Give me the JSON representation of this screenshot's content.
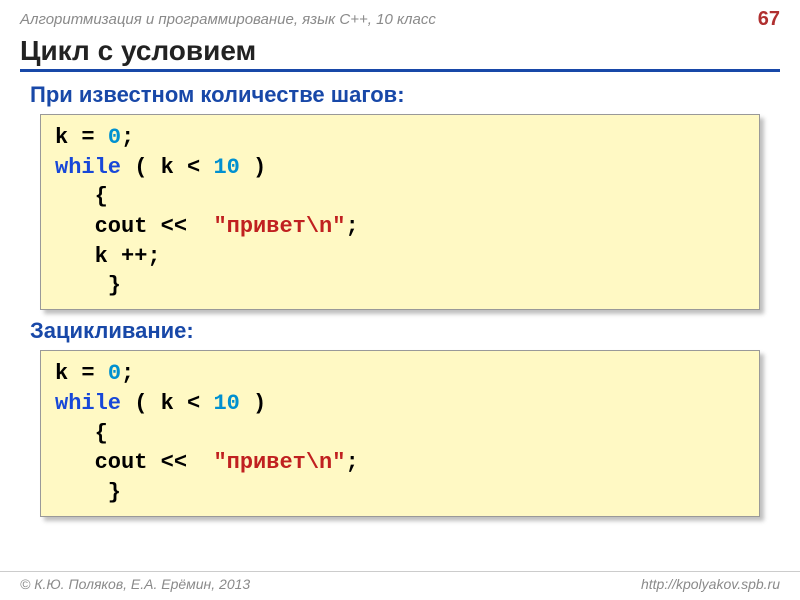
{
  "header": {
    "course": "Алгоритмизация и программирование, язык  C++, 10 класс",
    "page": "67"
  },
  "title": "Цикл с условием",
  "section1": {
    "heading": "При известном количестве шагов:",
    "code": {
      "l1a": "k = ",
      "l1b": "0",
      "l1c": ";",
      "l2a": "while",
      "l2b": " ( k < ",
      "l2c": "10",
      "l2d": " )",
      "l3": "   {",
      "l4a": "   cout <<  ",
      "l4b": "\"привет\\n\"",
      "l4c": ";",
      "l5": "   k ++;",
      "l6": "    }"
    }
  },
  "section2": {
    "heading": "Зацикливание:",
    "code": {
      "l1a": "k = ",
      "l1b": "0",
      "l1c": ";",
      "l2a": "while",
      "l2b": " ( k < ",
      "l2c": "10",
      "l2d": " )",
      "l3": "   {",
      "l4a": "   cout <<  ",
      "l4b": "\"привет\\n\"",
      "l4c": ";",
      "l5": "    }"
    }
  },
  "footer": {
    "left": "© К.Ю. Поляков, Е.А. Ерёмин, 2013",
    "right": "http://kpolyakov.spb.ru"
  }
}
